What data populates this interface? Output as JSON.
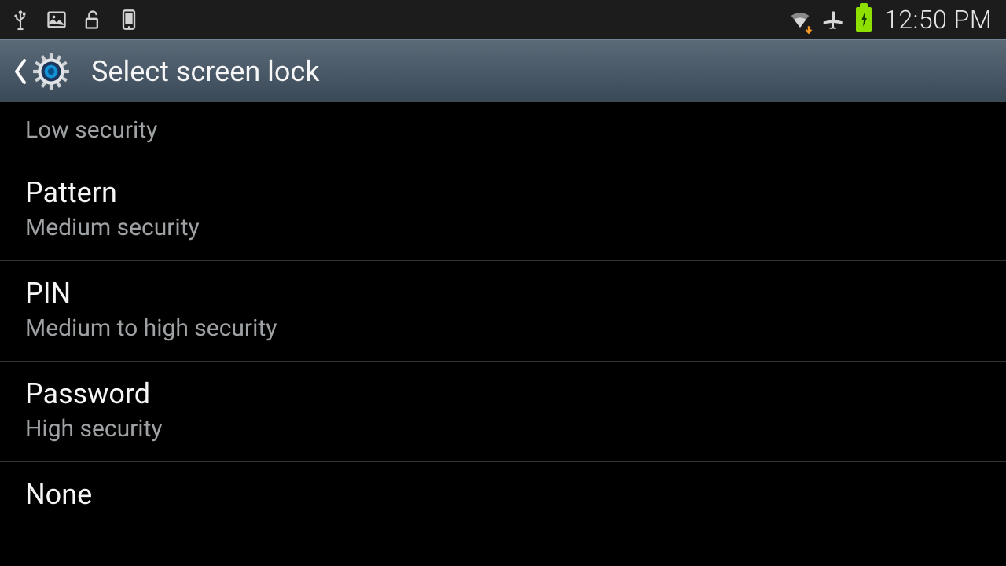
{
  "statusbar": {
    "time": "12:50 PM"
  },
  "titlebar": {
    "title": "Select screen lock"
  },
  "section": {
    "header": "Low security"
  },
  "items": [
    {
      "title": "Pattern",
      "sub": "Medium security"
    },
    {
      "title": "PIN",
      "sub": "Medium to high security"
    },
    {
      "title": "Password",
      "sub": "High security"
    },
    {
      "title": "None",
      "sub": ""
    }
  ]
}
